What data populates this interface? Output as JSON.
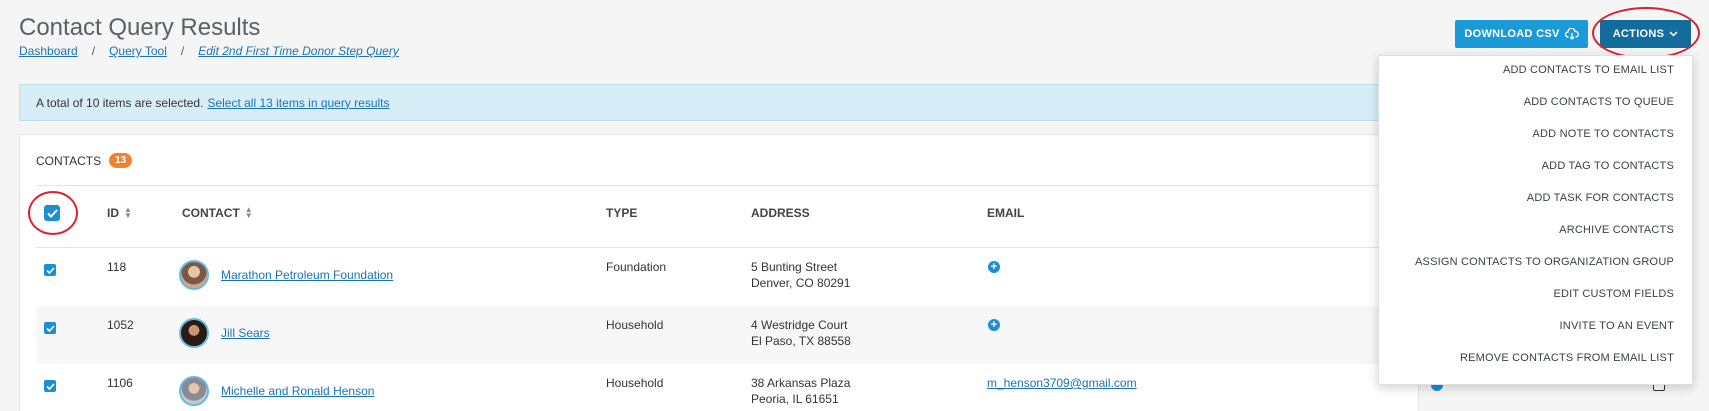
{
  "header": {
    "title": "Contact Query Results",
    "breadcrumb": [
      "Dashboard",
      "Query Tool",
      "Edit 2nd First Time Donor Step Query"
    ],
    "breadcrumb_sep": "/",
    "download_label": "DOWNLOAD CSV",
    "actions_label": "ACTIONS"
  },
  "alert": {
    "text": "A total of 10 items are selected.",
    "link": "Select all 13 items in query results"
  },
  "contacts": {
    "label": "CONTACTS",
    "count": "13",
    "columns": [
      "ID",
      "CONTACT",
      "TYPE",
      "ADDRESS",
      "EMAIL"
    ],
    "rows": [
      {
        "id": "118",
        "name": "Marathon Petroleum Foundation",
        "type": "Foundation",
        "address1": "5 Bunting Street",
        "address2": "Denver, CO 80291",
        "email": ""
      },
      {
        "id": "1052",
        "name": "Jill Sears",
        "type": "Household",
        "address1": "4 Westridge Court",
        "address2": "El Paso, TX 88558",
        "email": ""
      },
      {
        "id": "1106",
        "name": "Michelle and Ronald Henson",
        "type": "Household",
        "address1": "38 Arkansas Plaza",
        "address2": "Peoria, IL 61651",
        "email": "m_henson3709@gmail.com"
      }
    ]
  },
  "actions_menu": [
    "ADD CONTACTS TO EMAIL LIST",
    "ADD CONTACTS TO QUEUE",
    "ADD NOTE TO CONTACTS",
    "ADD TAG TO CONTACTS",
    "ADD TASK FOR CONTACTS",
    "ARCHIVE CONTACTS",
    "ASSIGN CONTACTS TO ORGANIZATION GROUP",
    "EDIT CUSTOM FIELDS",
    "INVITE TO AN EVENT",
    "REMOVE CONTACTS FROM EMAIL LIST"
  ],
  "icons": {
    "download": "cloud-download-icon",
    "actions": "chevron-down-icon",
    "checkbox": "checkmark-icon",
    "add": "plus-circle-icon"
  },
  "colors": {
    "primary": "#1a9ad6",
    "actions_bg": "#126d9c",
    "badge": "#f0822d",
    "annotation": "#d9232e"
  }
}
